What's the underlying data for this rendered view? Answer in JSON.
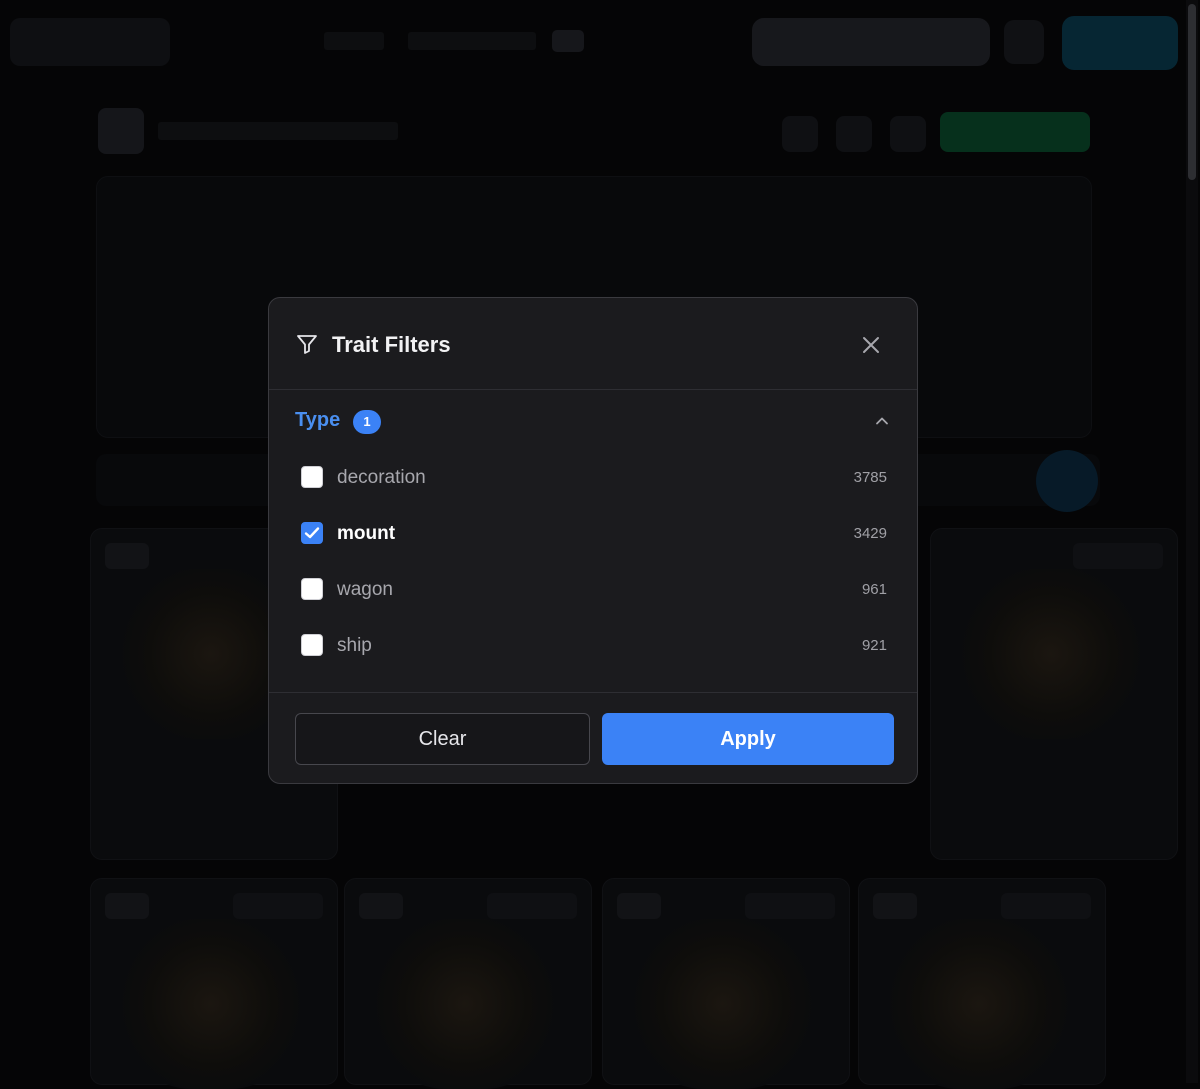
{
  "modal": {
    "title": "Trait Filters",
    "icons": {
      "title": "filter-icon",
      "close": "close-icon",
      "collapse": "chevron-up-icon"
    },
    "section": {
      "title": "Type",
      "selected_count": "1",
      "options": [
        {
          "label": "decoration",
          "count": "3785",
          "checked": false
        },
        {
          "label": "mount",
          "count": "3429",
          "checked": true
        },
        {
          "label": "wagon",
          "count": "961",
          "checked": false
        },
        {
          "label": "ship",
          "count": "921",
          "checked": false
        }
      ]
    },
    "buttons": {
      "clear": "Clear",
      "apply": "Apply"
    }
  },
  "colors": {
    "accent": "#3b82f6",
    "modal_bg": "#1b1b1e",
    "backdrop": "#050506"
  }
}
